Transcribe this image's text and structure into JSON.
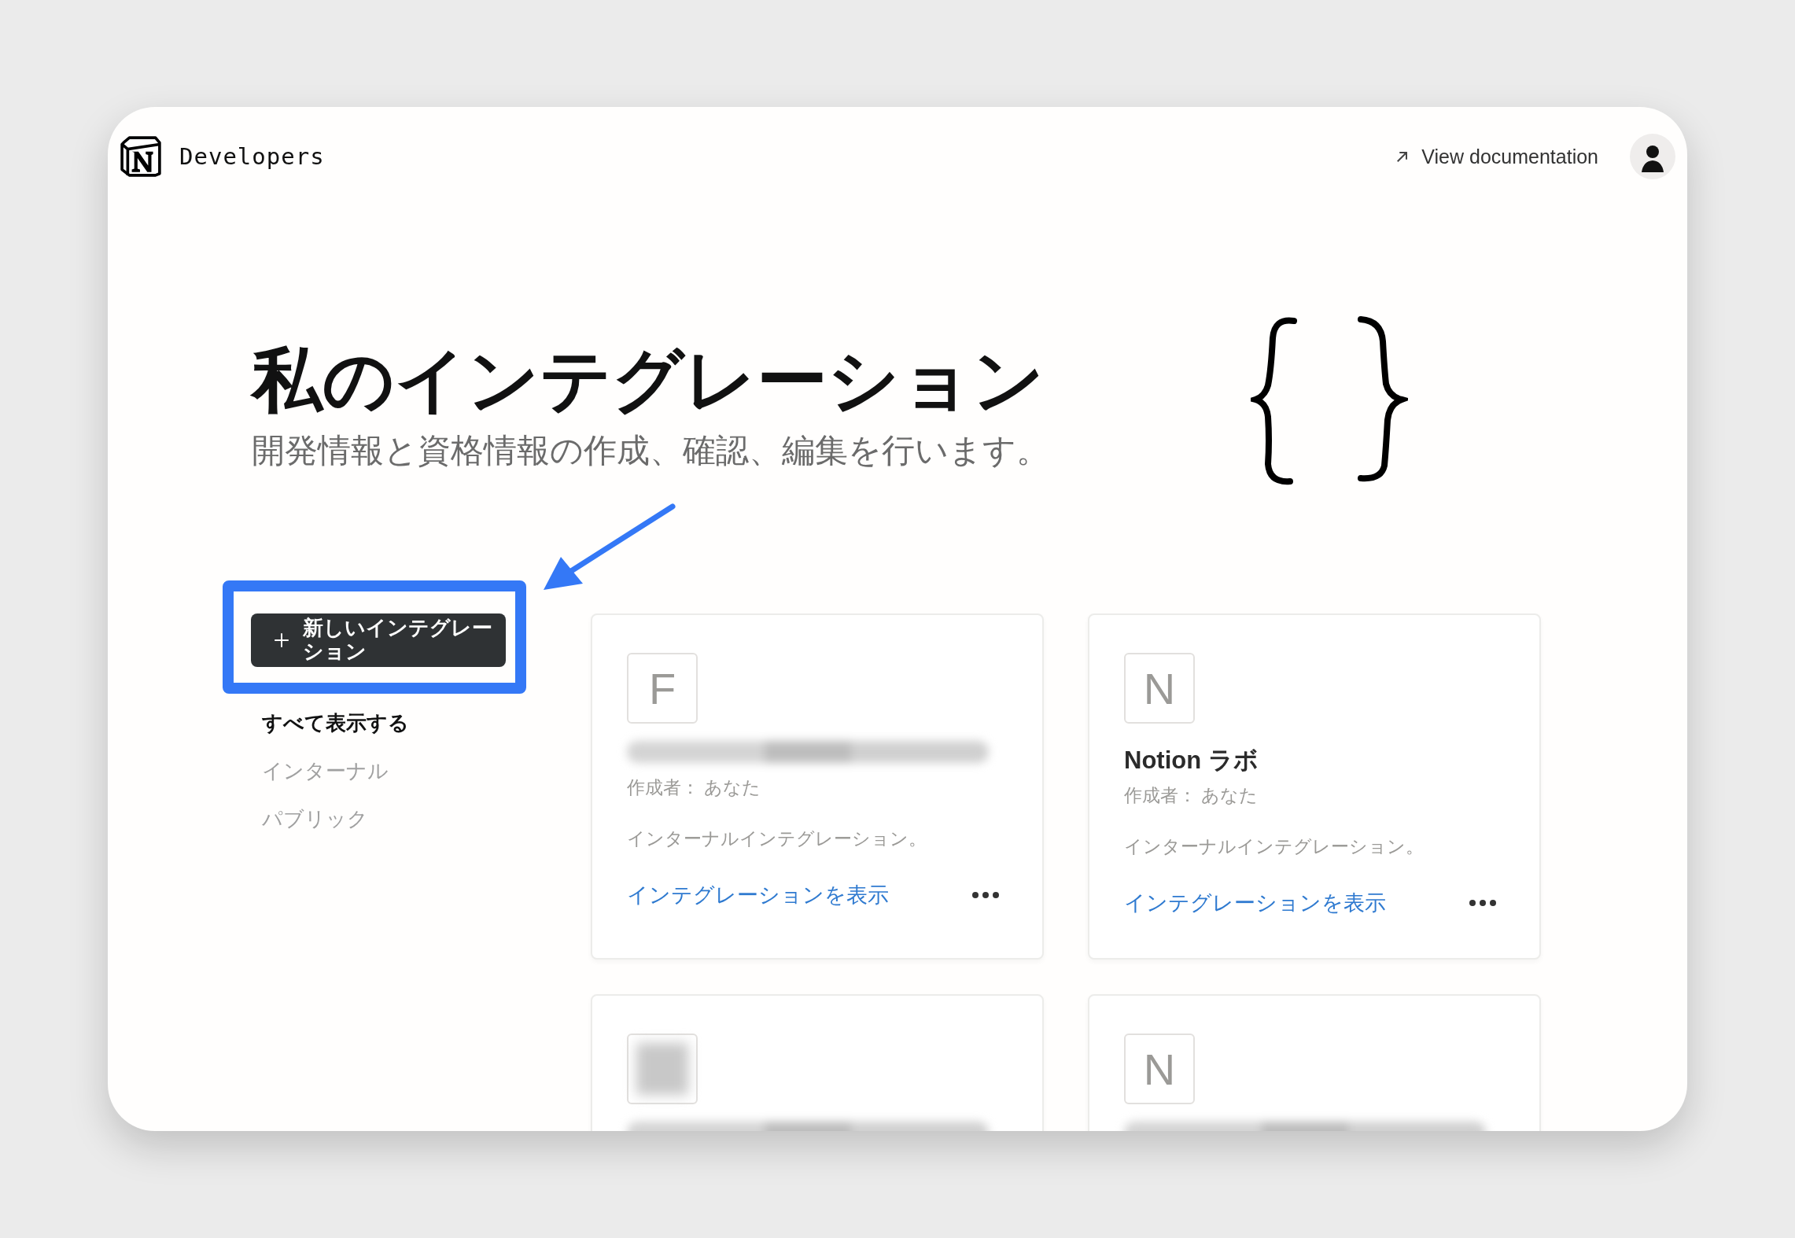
{
  "header": {
    "brand": "Developers",
    "doc_link": "View documentation"
  },
  "hero": {
    "title": "私のインテグレーション",
    "subtitle": "開発情報と資格情報の作成、確認、編集を行います。"
  },
  "new_button": {
    "label": "新しいインテグレーション",
    "highlighted": true
  },
  "filters": [
    {
      "label": "すべて表示する",
      "selected": true
    },
    {
      "label": "インターナル",
      "selected": false
    },
    {
      "label": "パブリック",
      "selected": false
    }
  ],
  "cards": [
    {
      "icon_letter": "F",
      "name_blurred": true,
      "creator": "作成者： あなた",
      "description": "インターナルインテグレーション。",
      "link": "インテグレーションを表示"
    },
    {
      "icon_letter": "N",
      "name": "Notion ラボ",
      "creator": "作成者： あなた",
      "description": "インターナルインテグレーション。",
      "link": "インテグレーションを表示"
    },
    {
      "icon_blurred": true,
      "name_blurred": true
    },
    {
      "icon_letter": "N",
      "name_blurred": true
    }
  ]
}
